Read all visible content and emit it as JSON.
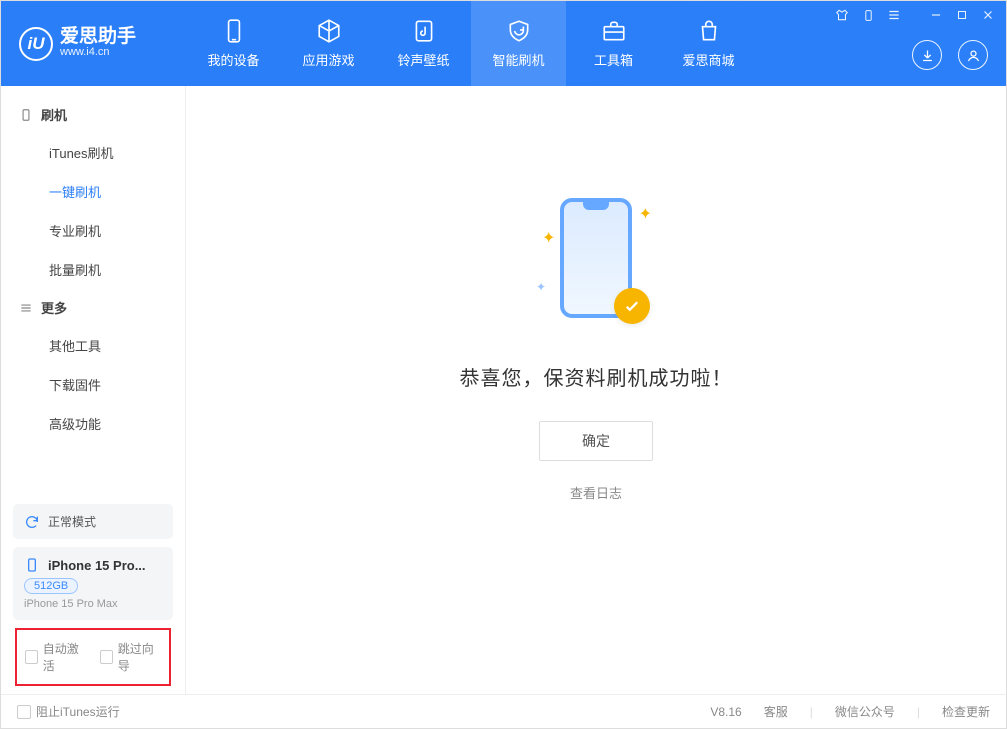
{
  "app": {
    "name": "爱思助手",
    "url": "www.i4.cn",
    "logo_initials": "iU",
    "version": "V8.16"
  },
  "nav_tabs": [
    {
      "label": "我的设备",
      "icon": "device"
    },
    {
      "label": "应用游戏",
      "icon": "cube"
    },
    {
      "label": "铃声壁纸",
      "icon": "music"
    },
    {
      "label": "智能刷机",
      "icon": "refresh",
      "active": true
    },
    {
      "label": "工具箱",
      "icon": "briefcase"
    },
    {
      "label": "爱思商城",
      "icon": "bag"
    }
  ],
  "sidebar": {
    "sections": [
      {
        "title": "刷机",
        "items": [
          {
            "label": "iTunes刷机"
          },
          {
            "label": "一键刷机",
            "active": true
          },
          {
            "label": "专业刷机"
          },
          {
            "label": "批量刷机"
          }
        ]
      },
      {
        "title": "更多",
        "items": [
          {
            "label": "其他工具"
          },
          {
            "label": "下载固件"
          },
          {
            "label": "高级功能"
          }
        ]
      }
    ],
    "status_mode": "正常模式",
    "device": {
      "name": "iPhone 15 Pro...",
      "capacity": "512GB",
      "model": "iPhone 15 Pro Max"
    },
    "highlight_options": {
      "auto_activate": "自动激活",
      "skip_wizard": "跳过向导"
    }
  },
  "main": {
    "success_message": "恭喜您，保资料刷机成功啦！",
    "confirm_label": "确定",
    "view_log_label": "查看日志"
  },
  "footer": {
    "block_itunes": "阻止iTunes运行",
    "links": {
      "support": "客服",
      "wechat": "微信公众号",
      "check_update": "检查更新"
    }
  }
}
